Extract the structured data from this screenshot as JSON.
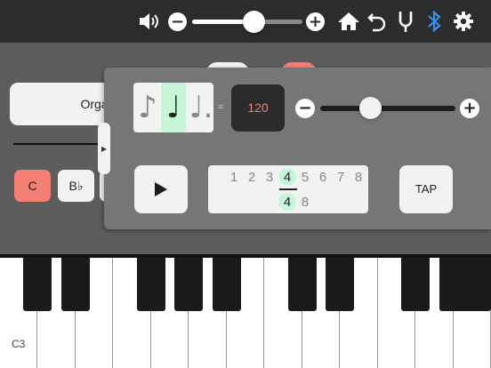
{
  "toolbar": {
    "volume_level": 0.56,
    "minus_label": "−",
    "plus_label": "+",
    "bluetooth_color": "#3d8ef0"
  },
  "main": {
    "instrument_label": "Orga",
    "keys": [
      {
        "label": "C",
        "active": true
      },
      {
        "label": "B♭",
        "active": false
      }
    ]
  },
  "metronome": {
    "note_values": [
      {
        "glyph": "♪",
        "name": "eighth-note",
        "selected": false
      },
      {
        "glyph": "♩",
        "name": "quarter-note",
        "selected": true
      },
      {
        "glyph": "♩.",
        "name": "dotted-quarter-note",
        "selected": false
      }
    ],
    "equals": "=",
    "tempo": "120",
    "tempo_slider_level": 0.37,
    "minus_label": "−",
    "plus_label": "+",
    "time_signature": {
      "numerators": [
        "1",
        "2",
        "3",
        "4",
        "5",
        "6",
        "7",
        "8"
      ],
      "selected_numerator": "4",
      "denominators": [
        "4",
        "8"
      ],
      "selected_denominator": "4"
    },
    "tap_label": "TAP",
    "collapse_icon": "▸"
  },
  "keyboard": {
    "start_label": "C3",
    "white_keys": 13
  },
  "colors": {
    "accent_coral": "#f37f75",
    "selection_mint": "#c6f5d8"
  }
}
